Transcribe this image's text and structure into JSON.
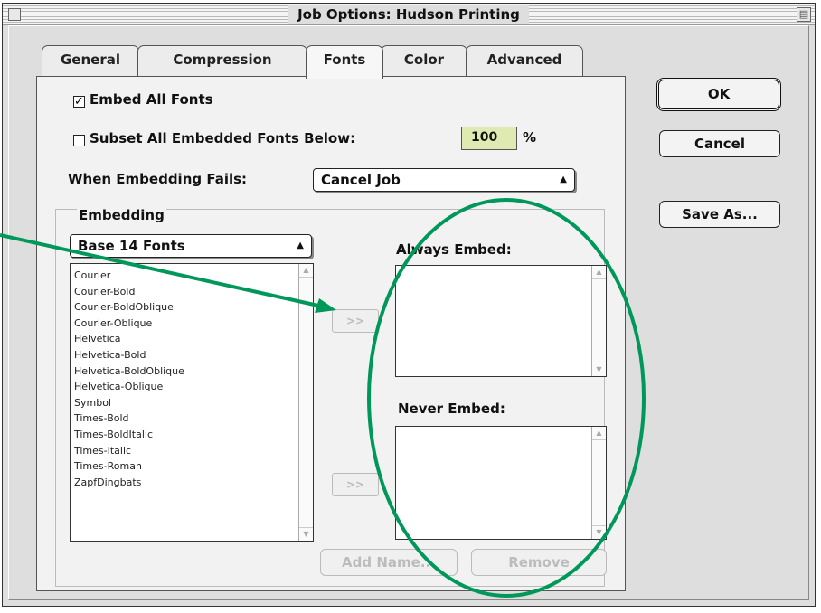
{
  "window": {
    "title": "Job Options: Hudson Printing"
  },
  "tabs": [
    {
      "label": "General"
    },
    {
      "label": "Compression"
    },
    {
      "label": "Fonts",
      "active": true
    },
    {
      "label": "Color"
    },
    {
      "label": "Advanced"
    }
  ],
  "buttons": {
    "ok": "OK",
    "cancel": "Cancel",
    "save_as": "Save As..."
  },
  "fonts_panel": {
    "embed_all_fonts": {
      "label": "Embed All Fonts",
      "checked": true
    },
    "subset_fonts": {
      "label": "Subset All Embedded Fonts Below:",
      "checked": false,
      "value": "100",
      "unit": "%"
    },
    "when_embedding_fails": {
      "label": "When Embedding Fails:",
      "selected": "Cancel Job"
    },
    "embedding": {
      "label": "Embedding",
      "source_selected": "Base 14 Fonts",
      "fonts": [
        "Courier",
        "Courier-Bold",
        "Courier-BoldOblique",
        "Courier-Oblique",
        "Helvetica",
        "Helvetica-Bold",
        "Helvetica-BoldOblique",
        "Helvetica-Oblique",
        "Symbol",
        "Times-Bold",
        "Times-BoldItalic",
        "Times-Italic",
        "Times-Roman",
        "ZapfDingbats"
      ],
      "add_to_always_button": ">>",
      "add_to_never_button": ">>",
      "always_embed_label": "Always Embed:",
      "never_embed_label": "Never Embed:",
      "add_name_button": "Add Name...",
      "remove_button": "Remove"
    }
  },
  "annotation": {
    "ellipse_color": "#00985a",
    "arrow_color": "#00985a"
  }
}
